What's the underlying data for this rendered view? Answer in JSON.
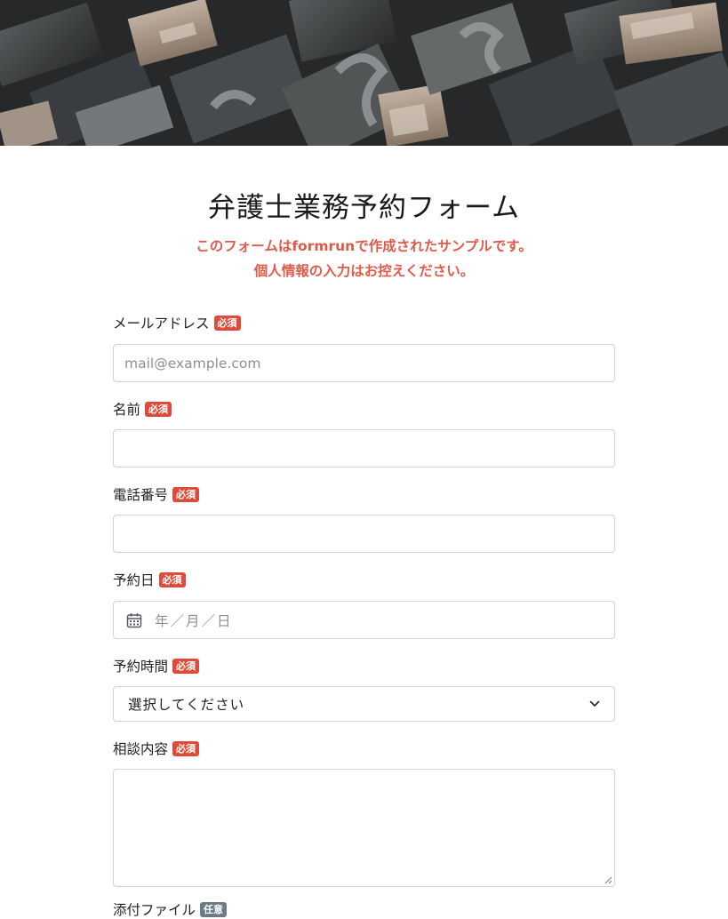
{
  "form": {
    "title": "弁護士業務予約フォーム",
    "notice_line1": "このフォームはformrunで作成されたサンプルです。",
    "notice_line2": "個人情報の入力はお控えください。",
    "required_badge": "必須",
    "optional_badge": "任意",
    "fields": {
      "email": {
        "label": "メールアドレス",
        "placeholder": "mail@example.com",
        "value": ""
      },
      "name": {
        "label": "名前",
        "value": ""
      },
      "phone": {
        "label": "電話番号",
        "value": ""
      },
      "date": {
        "label": "予約日",
        "placeholder": "年／月／日"
      },
      "time": {
        "label": "予約時間",
        "selected": "選択してください"
      },
      "consult": {
        "label": "相談内容",
        "value": ""
      },
      "attachment": {
        "label": "添付ファイル"
      }
    }
  },
  "icons": {
    "date": "calendar-icon",
    "select": "chevron-down-icon",
    "textarea": "resize-grip-icon"
  },
  "colors": {
    "accent": "#e05a4a",
    "required_badge": "#de4b3a",
    "optional_badge": "#6b7a89",
    "border": "#cfd3d7"
  }
}
